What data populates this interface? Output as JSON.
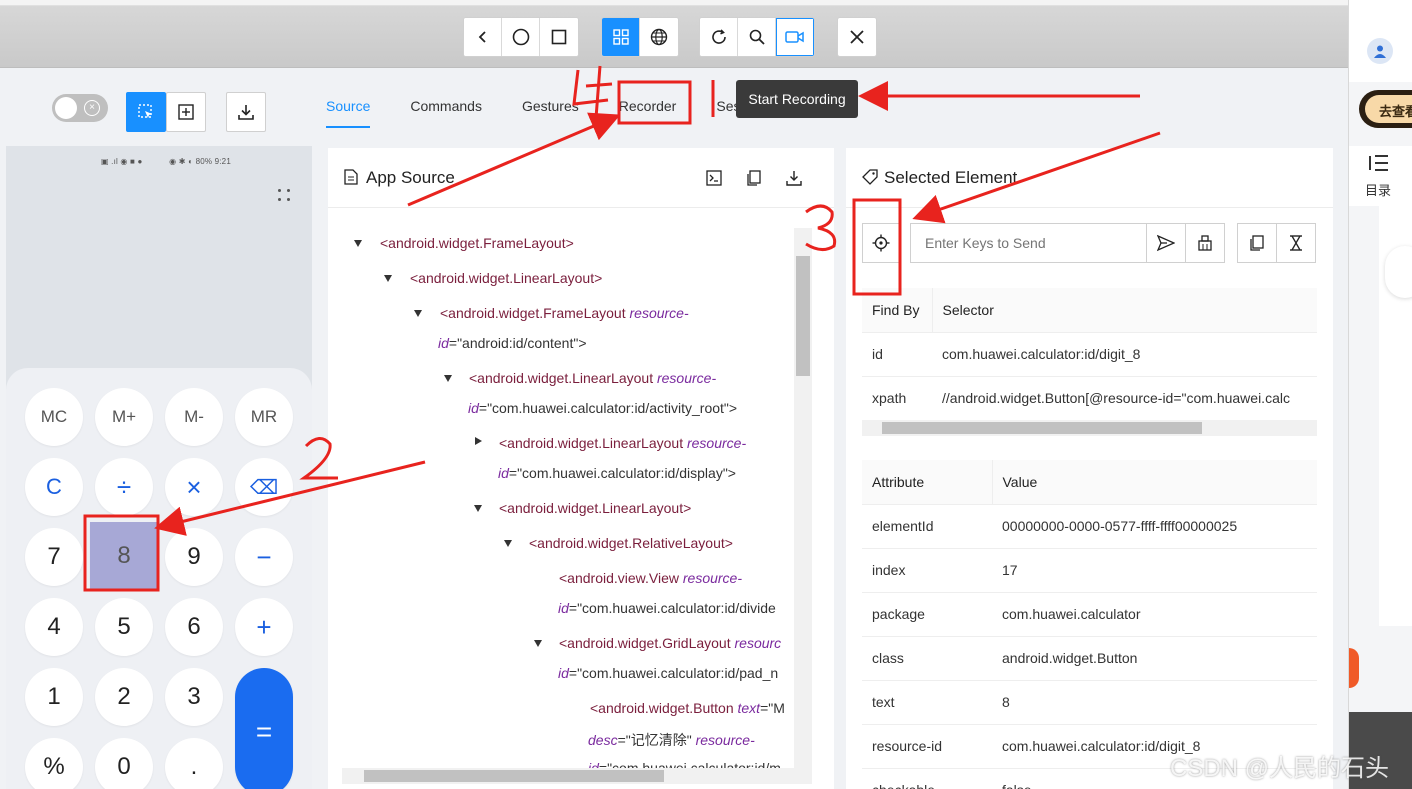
{
  "toolbar": {
    "nav_buttons": [
      "back",
      "home",
      "app-switch"
    ],
    "mode_buttons": [
      "native-mode",
      "web-mode"
    ],
    "action_buttons": [
      "refresh",
      "search",
      "start-recording"
    ],
    "close": "close"
  },
  "tooltip": "Start Recording",
  "tabs": [
    "Source",
    "Commands",
    "Gestures",
    "Recorder",
    "Session Information"
  ],
  "phone": {
    "status": "80% 9:21",
    "keys": [
      [
        "MC",
        "M+",
        "M-",
        "MR"
      ],
      [
        "C",
        "÷",
        "×",
        "⌫"
      ],
      [
        "7",
        "8",
        "9",
        "−"
      ],
      [
        "4",
        "5",
        "6",
        "+"
      ],
      [
        "1",
        "2",
        "3",
        "="
      ],
      [
        "%",
        "0",
        "."
      ]
    ]
  },
  "app_source": {
    "title": "App Source",
    "nodes": [
      {
        "tag": "<android.widget.FrameLayout>"
      },
      {
        "tag": "<android.widget.LinearLayout>"
      },
      {
        "tag": "<android.widget.FrameLayout",
        "attr": "resource-",
        "attr2": "id",
        "val": "=\"android:id/content\">"
      },
      {
        "tag": "<android.widget.LinearLayout",
        "attr": "resource-",
        "attr2": "id",
        "val": "=\"com.huawei.calculator:id/activity_root\">"
      },
      {
        "tag": "<android.widget.LinearLayout",
        "attr": "resource-",
        "attr2": "id",
        "val": "=\"com.huawei.calculator:id/display\">"
      },
      {
        "tag": "<android.widget.LinearLayout>"
      },
      {
        "tag": "<android.widget.RelativeLayout>"
      },
      {
        "tag": "<android.view.View",
        "attr": "resource-",
        "attr2": "id",
        "val": "=\"com.huawei.calculator:id/divide"
      },
      {
        "tag": "<android.widget.GridLayout",
        "attr": "resourc",
        "attr2": "id",
        "val": "=\"com.huawei.calculator:id/pad_n"
      },
      {
        "tag": "<android.widget.Button",
        "attr": "text",
        "val": "=\"M",
        "attr2": "desc",
        "val2": "=\"记忆清除\"",
        "attr3": "resource-",
        "attr4": "id",
        "val4": "=\"com.huawei.calculator:id/m"
      }
    ]
  },
  "selected_element": {
    "title": "Selected Element",
    "keys_placeholder": "Enter Keys to Send",
    "find_by_headers": [
      "Find By",
      "Selector"
    ],
    "find_by_rows": [
      [
        "id",
        "com.huawei.calculator:id/digit_8"
      ],
      [
        "xpath",
        "//android.widget.Button[@resource-id=\"com.huawei.calc"
      ]
    ],
    "attr_headers": [
      "Attribute",
      "Value"
    ],
    "attr_rows": [
      [
        "elementId",
        "00000000-0000-0577-ffff-ffff00000025"
      ],
      [
        "index",
        "17"
      ],
      [
        "package",
        "com.huawei.calculator"
      ],
      [
        "class",
        "android.widget.Button"
      ],
      [
        "text",
        "8"
      ],
      [
        "resource-id",
        "com.huawei.calculator:id/digit_8"
      ],
      [
        "checkable",
        "false"
      ]
    ]
  },
  "right_sidebar": {
    "go_label": "去查看",
    "toc_label": "目录"
  },
  "watermark": "CSDN @人民的石头",
  "annotations": [
    "1",
    "2",
    "3",
    "4"
  ],
  "colors": {
    "accent": "#1890ff",
    "annotation": "#e8231e"
  }
}
